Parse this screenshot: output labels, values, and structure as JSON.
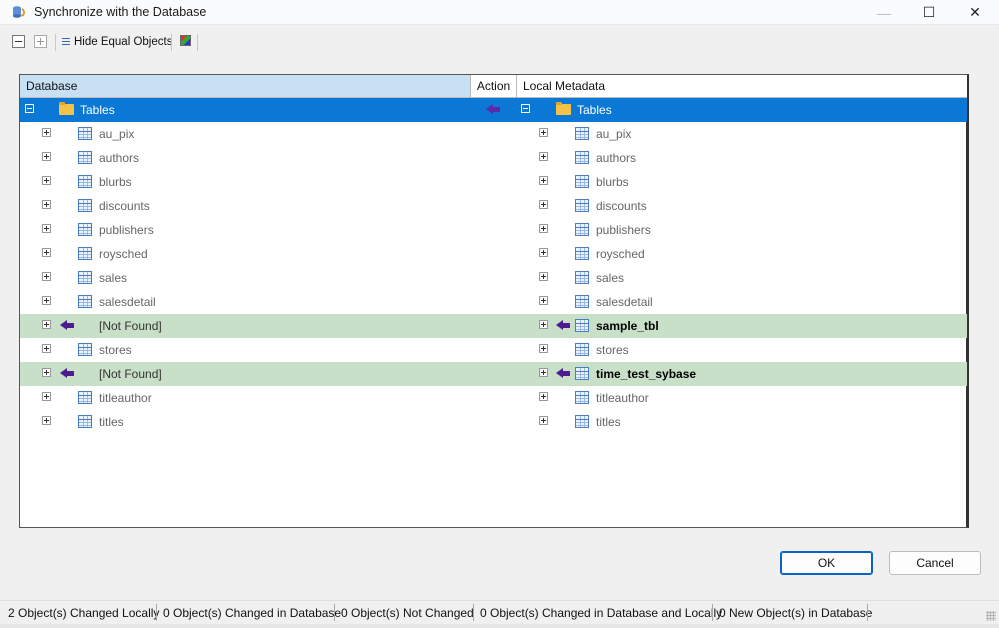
{
  "window": {
    "title": "Synchronize with the Database",
    "minimize_label": "—",
    "maximize_label": "☐",
    "close_label": "✕"
  },
  "toolbar": {
    "hide_equal_label": "Hide Equal Objects"
  },
  "grid": {
    "headers": {
      "database": "Database",
      "action": "Action",
      "local": "Local Metadata"
    },
    "group": {
      "database": "Tables",
      "local": "Tables"
    },
    "rows": [
      {
        "database": "au_pix",
        "local": "au_pix",
        "status": "equal"
      },
      {
        "database": "authors",
        "local": "authors",
        "status": "equal"
      },
      {
        "database": "blurbs",
        "local": "blurbs",
        "status": "equal"
      },
      {
        "database": "discounts",
        "local": "discounts",
        "status": "equal"
      },
      {
        "database": "publishers",
        "local": "publishers",
        "status": "equal"
      },
      {
        "database": "roysched",
        "local": "roysched",
        "status": "equal"
      },
      {
        "database": "sales",
        "local": "sales",
        "status": "equal"
      },
      {
        "database": "salesdetail",
        "local": "salesdetail",
        "status": "equal"
      },
      {
        "database": "[Not Found]",
        "local": "sample_tbl",
        "status": "changed"
      },
      {
        "database": "stores",
        "local": "stores",
        "status": "equal"
      },
      {
        "database": "[Not Found]",
        "local": "time_test_sybase",
        "status": "changed"
      },
      {
        "database": "titleauthor",
        "local": "titleauthor",
        "status": "equal"
      },
      {
        "database": "titles",
        "local": "titles",
        "status": "equal"
      }
    ]
  },
  "buttons": {
    "ok": "OK",
    "cancel": "Cancel"
  },
  "statusbar": {
    "changed_locally": "2 Object(s) Changed Locally",
    "changed_in_db": "0 Object(s) Changed in Database",
    "not_changed": "0 Object(s) Not Changed",
    "changed_both": "0 Object(s) Changed in Database and Locally",
    "new_in_db": "0 New Object(s) in Database"
  },
  "colors": {
    "selection": "#0a78d4",
    "changed_row": "#c8e0c8",
    "arrow": "#4b1d8f",
    "header_highlight": "#c8e0f4"
  }
}
